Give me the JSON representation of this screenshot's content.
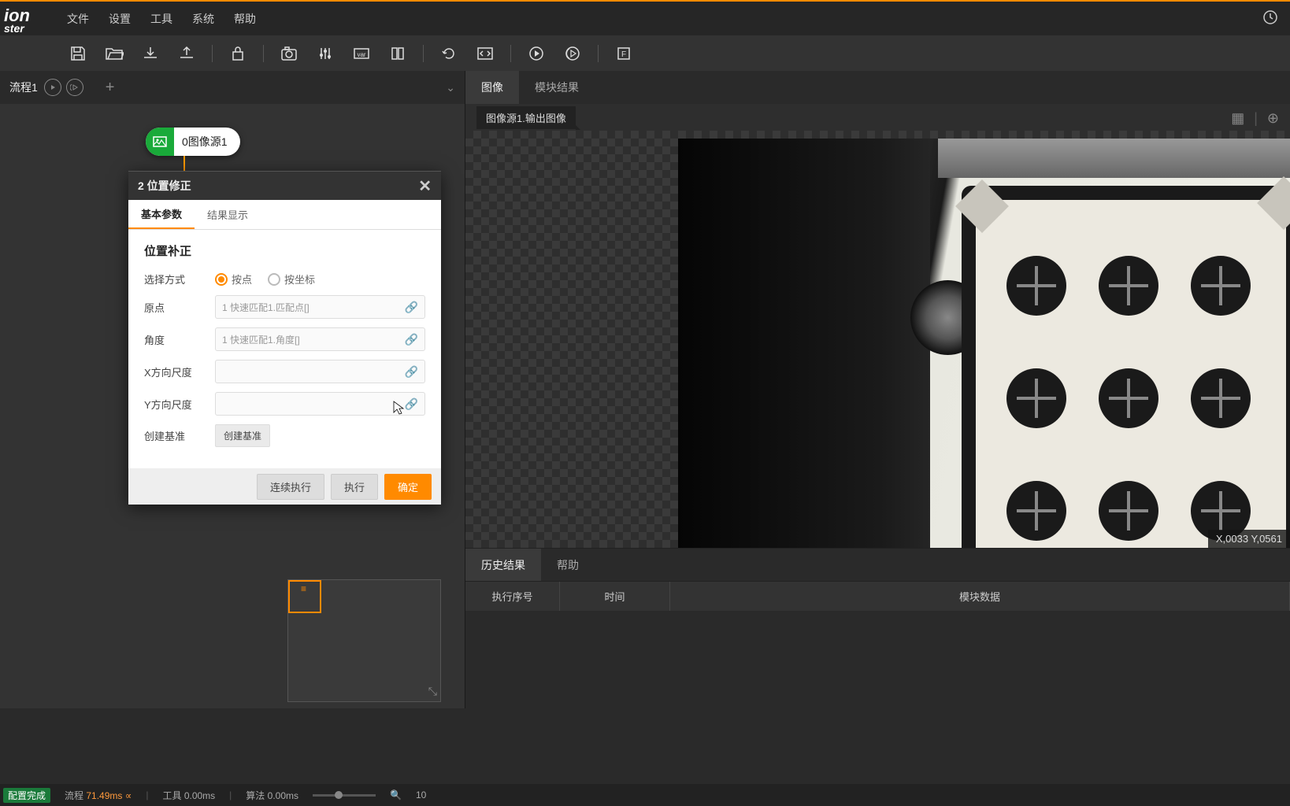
{
  "logo": {
    "line1": "ion",
    "line2": "ster"
  },
  "menubar": [
    "文件",
    "设置",
    "工具",
    "系统",
    "帮助"
  ],
  "flow": {
    "tab_name": "流程1",
    "add_label": "+",
    "node0_label": "0图像源1"
  },
  "dialog": {
    "title": "2 位置修正",
    "tabs": {
      "basic": "基本参数",
      "result": "结果显示"
    },
    "section_title": "位置补正",
    "rows": {
      "select_method": "选择方式",
      "radio_point": "按点",
      "radio_coord": "按坐标",
      "origin": "原点",
      "origin_val": "1 快速匹配1.匹配点[]",
      "angle": "角度",
      "angle_val": "1 快速匹配1.角度[]",
      "x_scale": "X方向尺度",
      "y_scale": "Y方向尺度",
      "create_base": "创建基准",
      "create_base_btn": "创建基准"
    },
    "footer": {
      "cont_exec": "连续执行",
      "exec": "执行",
      "confirm": "确定"
    }
  },
  "right": {
    "tabs": {
      "image": "图像",
      "module_result": "模块结果"
    },
    "img_source_tag": "图像源1.输出图像",
    "coord_text": "X,0033  Y,0561",
    "bottom_tabs": {
      "history": "历史结果",
      "help": "帮助"
    },
    "table_headers": {
      "seq": "执行序号",
      "time": "时间",
      "data": "模块数据"
    }
  },
  "status": {
    "config_done": "配置完成",
    "flow_label": "流程",
    "flow_time": "71.49ms",
    "tool_label": "工具",
    "tool_time": "0.00ms",
    "algo_label": "算法",
    "algo_time": "0.00ms",
    "zoom_val": "10"
  }
}
